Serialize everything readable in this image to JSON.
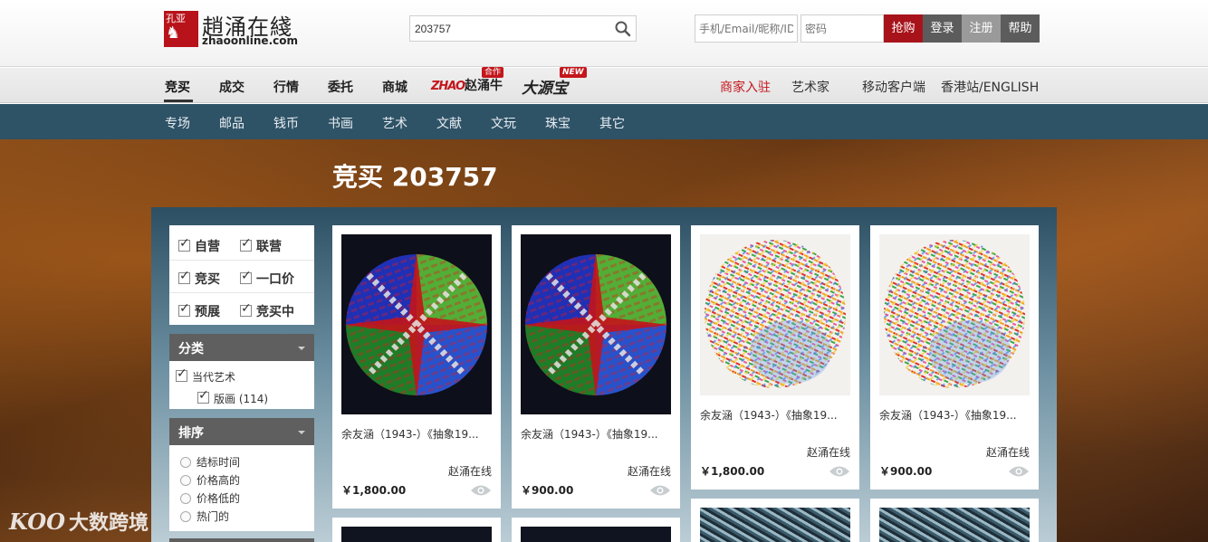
{
  "header": {
    "logo_seal_text": "孔亚",
    "logo_cn": "趙涌在綫",
    "logo_en": "zhaoonline.com",
    "search_value": "203757",
    "username_placeholder": "手机/Email/昵称/ID",
    "password_placeholder": "密码",
    "buttons": {
      "grab": "抢购",
      "login": "登录",
      "register": "注册",
      "help": "帮助"
    },
    "colors": {
      "grab": "#a8131b",
      "login": "#5c5c5c",
      "register": "#9a9a9a",
      "help": "#5c5c5c"
    }
  },
  "main_nav": {
    "items": [
      "竞买",
      "成交",
      "行情",
      "委托",
      "商城"
    ],
    "active": "竞买",
    "brand1_prefix": "ZHAO",
    "brand1_name": "赵涌牛",
    "brand1_tag": "合作",
    "brand2_name": "大源宝",
    "brand2_tag": "NEW",
    "right_items": [
      "商家入驻",
      "艺术家",
      "移动客户端",
      "香港站/ENGLISH"
    ]
  },
  "sub_nav": {
    "items": [
      "专场",
      "邮品",
      "钱币",
      "书画",
      "艺术",
      "文献",
      "文玩",
      "珠宝",
      "其它"
    ]
  },
  "page_title": "竞买 203757",
  "filters": {
    "rows": [
      [
        "自营",
        "联营"
      ],
      [
        "竞买",
        "一口价"
      ],
      [
        "预展",
        "竞买中"
      ]
    ]
  },
  "category_panel": {
    "title": "分类",
    "top": "当代艺术",
    "sub": "版画 (114)"
  },
  "sort_panel": {
    "title": "排序",
    "options": [
      "结标时间",
      "价格高的",
      "价格低的",
      "热门的"
    ]
  },
  "products": [
    {
      "title": "余友涵（1943-）《抽象19...",
      "seller": "赵涌在线",
      "price": "￥1,800.00",
      "art": "cross"
    },
    {
      "title": "余友涵（1943-）《抽象19...",
      "seller": "赵涌在线",
      "price": "￥900.00",
      "art": "cross"
    },
    {
      "title": "余友涵（1943-）《抽象19...",
      "seller": "赵涌在线",
      "price": "￥1,800.00",
      "art": "circle"
    },
    {
      "title": "余友涵（1943-）《抽象19...",
      "seller": "赵涌在线",
      "price": "￥900.00",
      "art": "circle"
    }
  ],
  "watermark": {
    "logo": "KOO",
    "text": "大数跨境"
  }
}
